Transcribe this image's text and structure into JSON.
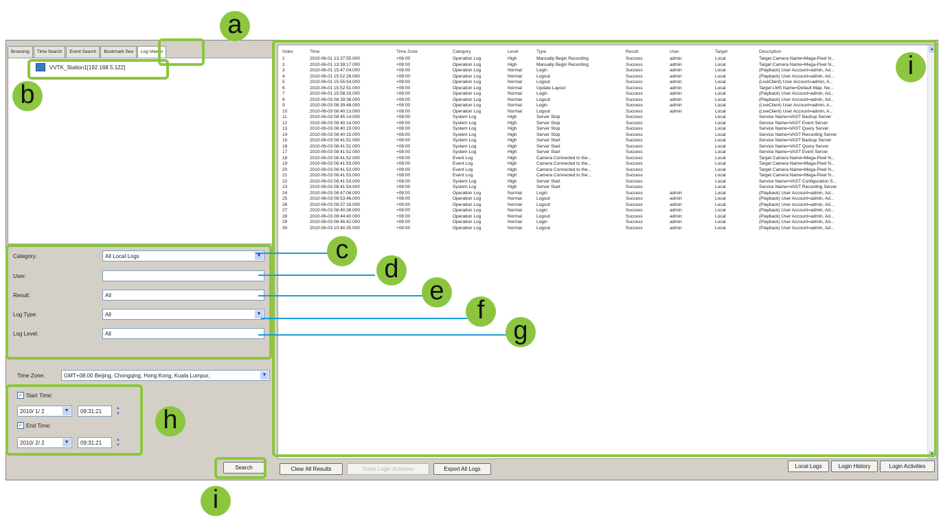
{
  "tabs": [
    "Browsing",
    "Time Search",
    "Event Search",
    "Bookmark Sea",
    "Log Viewer"
  ],
  "tree_item": "VVTK_Station1[192.168.5.122]",
  "filters": [
    {
      "label": "Category:",
      "value": "All Local Logs"
    },
    {
      "label": "User:",
      "value": ""
    },
    {
      "label": "Result:",
      "value": "All"
    },
    {
      "label": "Log Type:",
      "value": "All"
    },
    {
      "label": "Log Level:",
      "value": "All"
    }
  ],
  "time_zone": {
    "label": "Time Zone:",
    "value": "GMT+08:00 Beijing, Chongqing, Hong Kong, Kuala Lumpur,"
  },
  "start_time": {
    "label": "Start Time:",
    "date": "2010/ 1/ 2",
    "time": "09:31:21"
  },
  "end_time": {
    "label": "End Time:",
    "date": "2010/ 2/ 2",
    "time": "09:31:21"
  },
  "buttons": {
    "search": "Search",
    "clear": "Clear All Results",
    "track": "Track Login Activities",
    "export": "Export All Logs",
    "local_logs": "Local Logs",
    "login_history": "Login History",
    "login_activities": "Login Activities"
  },
  "table": {
    "columns": [
      "Index",
      "Time",
      "Time Zone",
      "Category",
      "Level",
      "Type",
      "Result",
      "User",
      "Target",
      "Description"
    ],
    "rows": [
      [
        "1",
        "2010-06-01 13:37:55.000",
        "+08:00",
        "Operation Log",
        "High",
        "Manually Begin Recording",
        "Success",
        "admin",
        "Local",
        "Target Camera Name=Mega-Pixel N..."
      ],
      [
        "2",
        "2010-06-01 13:39:17.000",
        "+08:00",
        "Operation Log",
        "High",
        "Manually Begin Recording",
        "Success",
        "admin",
        "Local",
        "Target Camera Name=Mega-Pixel N..."
      ],
      [
        "3",
        "2010-06-01 15:47:04.000",
        "+08:00",
        "Operation Log",
        "Normal",
        "Login",
        "Success",
        "admin",
        "Local",
        "(Playback) User Account=admin, Ad..."
      ],
      [
        "4",
        "2010-06-01 15:52:26.000",
        "+08:00",
        "Operation Log",
        "Normal",
        "Logout",
        "Success",
        "admin",
        "Local",
        "(Playback) User Account=admin, Ad..."
      ],
      [
        "5",
        "2010-06-01 15:55:54.000",
        "+08:00",
        "Operation Log",
        "Normal",
        "Logout",
        "Success",
        "admin",
        "Local",
        "(LiveClient) User Account=admin, A..."
      ],
      [
        "6",
        "2010-06-01 15:52:51.000",
        "+08:00",
        "Operation Log",
        "Normal",
        "Update Layout",
        "Success",
        "admin",
        "Local",
        "Target LMS Name=Default Map, Ne..."
      ],
      [
        "7",
        "2010-06-01 15:58:33.000",
        "+08:00",
        "Operation Log",
        "Normal",
        "Login",
        "Success",
        "admin",
        "Local",
        "(Playback) User Account=admin, Ad..."
      ],
      [
        "8",
        "2010-06-03 08:39:36.000",
        "+08:00",
        "Operation Log",
        "Normal",
        "Logout",
        "Success",
        "admin",
        "Local",
        "(Playback) User Account=admin, Ad..."
      ],
      [
        "9",
        "2010-06-03 08:39:48.000",
        "+08:00",
        "Operation Log",
        "Normal",
        "Login",
        "Success",
        "admin",
        "Local",
        "(LiveClient) User Account=admin, A..."
      ],
      [
        "10",
        "2010-06-03 08:40:13.000",
        "+08:00",
        "Operation Log",
        "Normal",
        "Logout",
        "Success",
        "admin",
        "Local",
        "(LiveClient) User Account=admin, A..."
      ],
      [
        "11",
        "2010-06-03 08:45:14.000",
        "+08:00",
        "System Log",
        "High",
        "Server Stop",
        "Success",
        "",
        "Local",
        "Service Name=VAST Backup Server"
      ],
      [
        "12",
        "2010-06-03 08:40:14.000",
        "+08:00",
        "System Log",
        "High",
        "Server Stop",
        "Success",
        "",
        "Local",
        "Service Name=VAST Event Server"
      ],
      [
        "13",
        "2010-06-03 08:40:15.000",
        "+08:00",
        "System Log",
        "High",
        "Server Stop",
        "Success",
        "",
        "Local",
        "Service Name=VAST Query Server"
      ],
      [
        "14",
        "2010-06-03 08:40:15.000",
        "+08:00",
        "System Log",
        "High",
        "Server Stop",
        "Success",
        "",
        "Local",
        "Service Name=VAST Recording Server"
      ],
      [
        "15",
        "2010-06-03 08:41:51.000",
        "+08:00",
        "System Log",
        "High",
        "Server Start",
        "Success",
        "",
        "Local",
        "Service Name=VAST Backup Server"
      ],
      [
        "16",
        "2010-06-03 08:41:51.000",
        "+08:00",
        "System Log",
        "High",
        "Server Start",
        "Success",
        "",
        "Local",
        "Service Name=VAST Query Server"
      ],
      [
        "17",
        "2010-06-03 08:41:52.000",
        "+08:00",
        "System Log",
        "High",
        "Server Start",
        "Success",
        "",
        "Local",
        "Service Name=VAST Event Server"
      ],
      [
        "18",
        "2010-06-03 08:41:52.000",
        "+08:00",
        "Event Log",
        "High",
        "Camera Connected to the...",
        "Success",
        "",
        "Local",
        "Target Camera Name=Mega-Pixel N..."
      ],
      [
        "19",
        "2010-06-03 08:41:53.000",
        "+08:00",
        "Event Log",
        "High",
        "Camera Connected to the...",
        "Success",
        "",
        "Local",
        "Target Camera Name=Mega-Pixel N..."
      ],
      [
        "20",
        "2010-06-03 08:41:53.000",
        "+08:00",
        "Event Log",
        "High",
        "Camera Connected to the...",
        "Success",
        "",
        "Local",
        "Target Camera Name=Mega-Pixel N..."
      ],
      [
        "21",
        "2010-06-03 08:41:53.000",
        "+08:00",
        "Event Log",
        "High",
        "Camera Connected to the...",
        "Success",
        "",
        "Local",
        "Target Camera Name=Mega-Pixel N..."
      ],
      [
        "22",
        "2010-06-03 08:41:53.000",
        "+08:00",
        "System Log",
        "High",
        "Server Start",
        "Success",
        "",
        "Local",
        "Service Name=VAST Configuration S..."
      ],
      [
        "23",
        "2010-06-03 08:41:54.000",
        "+08:00",
        "System Log",
        "High",
        "Server Start",
        "Success",
        "",
        "Local",
        "Service Name=VAST Recording Server"
      ],
      [
        "24",
        "2010-06-03 08:47:06.000",
        "+08:00",
        "Operation Log",
        "Normal",
        "Login",
        "Success",
        "admin",
        "Local",
        "(Playback) User Account=admin, Ad..."
      ],
      [
        "25",
        "2010-06-03 08:53:46.000",
        "+08:00",
        "Operation Log",
        "Normal",
        "Logout",
        "Success",
        "admin",
        "Local",
        "(Playback) User Account=admin, Ad..."
      ],
      [
        "26",
        "2010-06-03 08:37:16.000",
        "+08:00",
        "Operation Log",
        "Normal",
        "Logout",
        "Success",
        "admin",
        "Local",
        "(Playback) User Account=admin, Ad..."
      ],
      [
        "27",
        "2010-06-03 08:40:38.000",
        "+08:00",
        "Operation Log",
        "Normal",
        "Login",
        "Success",
        "admin",
        "Local",
        "(Playback) User Account=admin, Ad..."
      ],
      [
        "28",
        "2010-06-03 08:44:40.000",
        "+08:00",
        "Operation Log",
        "Normal",
        "Logout",
        "Success",
        "admin",
        "Local",
        "(Playback) User Account=admin, Ad..."
      ],
      [
        "29",
        "2010-06-03 08:46:42.000",
        "+08:00",
        "Operation Log",
        "Normal",
        "Login",
        "Success",
        "admin",
        "Local",
        "(Playback) User Account=admin, Ad..."
      ],
      [
        "30",
        "2010-06-03 10:40:35.000",
        "+08:00",
        "Operation Log",
        "Normal",
        "Logout",
        "Success",
        "admin",
        "Local",
        "(Playback) User Account=admin, Ad..."
      ]
    ]
  },
  "callouts": [
    "a",
    "b",
    "c",
    "d",
    "e",
    "f",
    "g",
    "h",
    "i",
    "i"
  ],
  "accent_color": "#8cc63f",
  "line_color": "#1a9ad6"
}
